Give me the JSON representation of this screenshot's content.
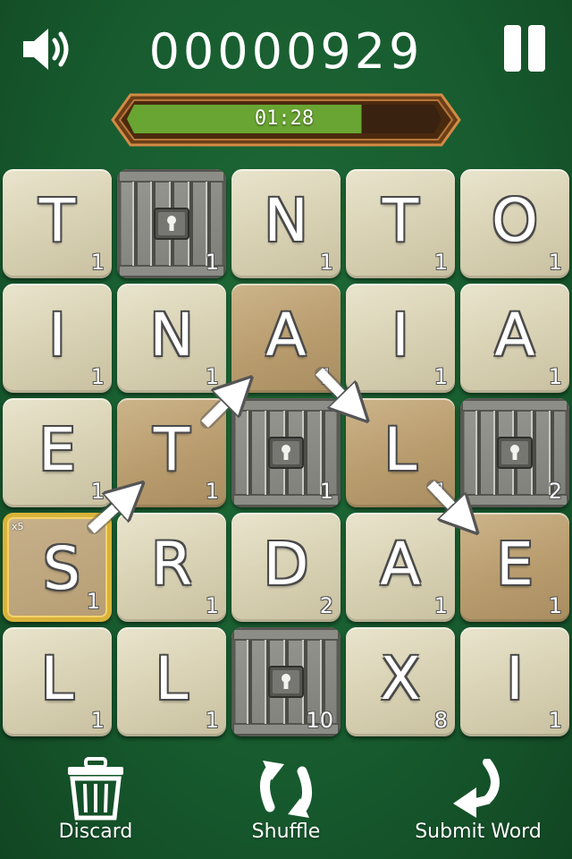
{
  "header": {
    "score": "00000929",
    "timer": "01:28",
    "timer_progress": 0.75
  },
  "colors": {
    "felt": "#16552c",
    "tile": "#d7d0b2",
    "tile_selected": "#b89c6e",
    "bonus_border": "#d9b23a",
    "timer_fill": "#6aa533"
  },
  "board": {
    "rows": [
      [
        {
          "letter": "T",
          "points": "1"
        },
        {
          "letter": "",
          "points": "1",
          "locked": true
        },
        {
          "letter": "N",
          "points": "1"
        },
        {
          "letter": "T",
          "points": "1"
        },
        {
          "letter": "O",
          "points": "1"
        }
      ],
      [
        {
          "letter": "I",
          "points": "1"
        },
        {
          "letter": "N",
          "points": "1"
        },
        {
          "letter": "A",
          "points": "1",
          "selected": true
        },
        {
          "letter": "I",
          "points": "1"
        },
        {
          "letter": "A",
          "points": "1"
        }
      ],
      [
        {
          "letter": "E",
          "points": "1"
        },
        {
          "letter": "T",
          "points": "1",
          "selected": true
        },
        {
          "letter": "",
          "points": "1",
          "locked": true
        },
        {
          "letter": "L",
          "points": "1",
          "selected": true
        },
        {
          "letter": "",
          "points": "2",
          "locked": true
        }
      ],
      [
        {
          "letter": "S",
          "points": "1",
          "bonus": true,
          "multiplier": "x5"
        },
        {
          "letter": "R",
          "points": "1"
        },
        {
          "letter": "D",
          "points": "2"
        },
        {
          "letter": "A",
          "points": "1"
        },
        {
          "letter": "E",
          "points": "1",
          "selected": true
        }
      ],
      [
        {
          "letter": "L",
          "points": "1"
        },
        {
          "letter": "L",
          "points": "1"
        },
        {
          "letter": "",
          "points": "10",
          "locked": true
        },
        {
          "letter": "X",
          "points": "8"
        },
        {
          "letter": "I",
          "points": "1"
        }
      ]
    ]
  },
  "actions": {
    "discard_label": "Discard",
    "shuffle_label": "Shuffle",
    "submit_label": "Submit Word"
  }
}
